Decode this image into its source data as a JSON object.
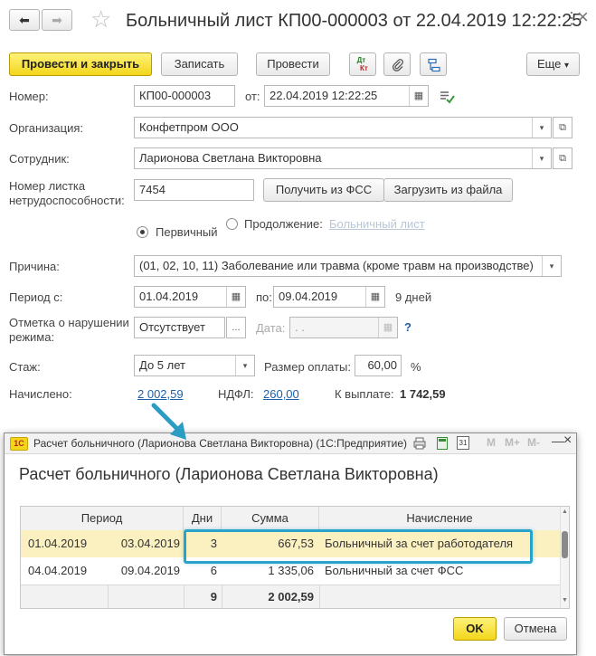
{
  "window": {
    "title": "Больничный лист КП00-000003 от 22.04.2019 12:22:25",
    "back_glyph": "⬅",
    "forward_glyph": "➡",
    "star_glyph": "☆",
    "close_glyph": "×",
    "more_glyph": "⋮"
  },
  "toolbar": {
    "post_close": "Провести и закрыть",
    "save": "Записать",
    "post": "Провести",
    "dtkt_top": "Дт",
    "dtkt_bottom": "Кт",
    "more": "Еще",
    "more_arrow": "▾"
  },
  "form": {
    "number_label": "Номер:",
    "number_value": "КП00-000003",
    "from_label": "от:",
    "date_value": "22.04.2019 12:22:25",
    "org_label": "Организация:",
    "org_value": "Конфетпром ООО",
    "employee_label": "Сотрудник:",
    "employee_value": "Ларионова Светлана Викторовна",
    "sheet_label_1": "Номер листка",
    "sheet_label_2": "нетрудоспособности:",
    "sheet_value": "7454",
    "get_fss": "Получить из ФСС",
    "load_file": "Загрузить из файла",
    "primary_label": "Первичный",
    "continuation_label": "Продолжение:",
    "sick_sheet_link": "Больничный лист",
    "reason_label": "Причина:",
    "reason_value": "(01, 02, 10, 11) Заболевание или травма (кроме травм на производстве)",
    "period_label": "Период с:",
    "period_from": "01.04.2019",
    "period_to_label": "по:",
    "period_to": "09.04.2019",
    "days_text": "9 дней",
    "violation_label_1": "Отметка о нарушении",
    "violation_label_2": "режима:",
    "violation_value": "Отсутствует",
    "violation_date_label": "Дата:",
    "violation_date_value": " .  .",
    "help": "?",
    "stazh_label": "Стаж:",
    "stazh_value": "До 5 лет",
    "pay_size_label": "Размер оплаты:",
    "pay_size_value": "60,00",
    "percent": "%",
    "accrued_label": "Начислено:",
    "accrued_value": "2 002,59",
    "ndfl_label": "НДФЛ:",
    "ndfl_value": "260,00",
    "to_pay_label": "К выплате:",
    "to_pay_value": "1 742,59",
    "dots": "...",
    "dd_arrow": "▾",
    "open_glyph": "⧉",
    "cal_glyph": "▦"
  },
  "dialog": {
    "logo": "1С",
    "title": "Расчет больничного (Ларионова Светлана Викторовна)  (1С:Предприятие)",
    "heading": "Расчет больничного (Ларионова Светлана Викторовна)",
    "tb_m": "M",
    "tb_mplus": "M+",
    "tb_mminus": "M-",
    "tb_min": "—",
    "tb_max": "☐",
    "tb_close": "×",
    "cal_day": "31",
    "columns": {
      "period": "Период",
      "days": "Дни",
      "sum": "Сумма",
      "accrual": "Начисление"
    },
    "rows": [
      {
        "from": "01.04.2019",
        "to": "03.04.2019",
        "days": "3",
        "sum": "667,53",
        "accrual": "Больничный за счет работодателя"
      },
      {
        "from": "04.04.2019",
        "to": "09.04.2019",
        "days": "6",
        "sum": "1 335,06",
        "accrual": "Больничный за счет ФСС"
      }
    ],
    "total_days": "9",
    "total_sum": "2 002,59",
    "ok": "OK",
    "cancel": "Отмена"
  },
  "colors": {
    "accent_yellow": "#f3d61a",
    "link_blue": "#1f5fa8",
    "highlight_frame": "#29a3c9",
    "arrow_teal": "#2b9cc4"
  }
}
